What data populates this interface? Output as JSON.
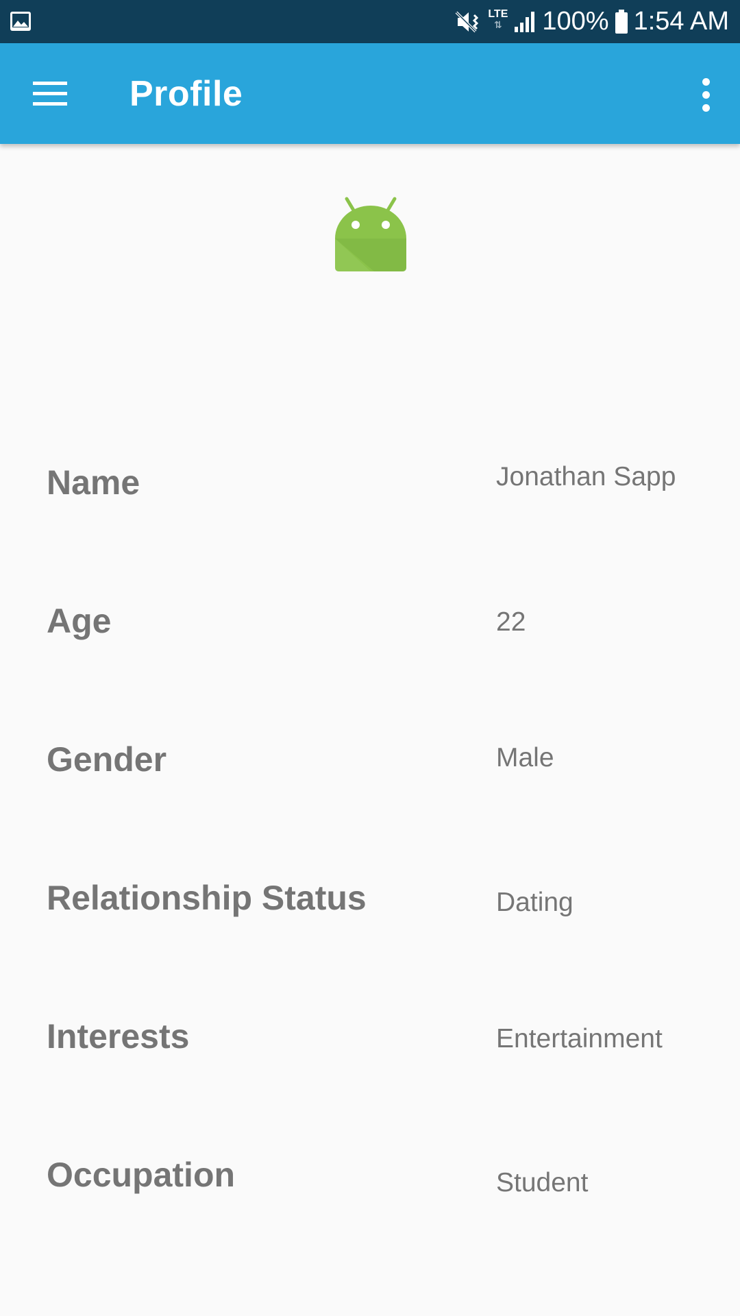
{
  "status_bar": {
    "battery": "100%",
    "time": "1:54 AM",
    "network": "LTE",
    "icons": [
      "image-notification-icon",
      "mute-vibrate-icon",
      "lte-icon",
      "signal-icon",
      "battery-icon"
    ]
  },
  "app_bar": {
    "title": "Profile",
    "background": "#29a5db",
    "menu_icon": "hamburger-menu-icon",
    "overflow_icon": "more-vert-icon"
  },
  "avatar": {
    "icon": "android-icon",
    "color": "#8bc34a"
  },
  "profile": {
    "rows": [
      {
        "label": "Name",
        "value": "Jonathan Sapp"
      },
      {
        "label": "Age",
        "value": "22"
      },
      {
        "label": "Gender",
        "value": "Male"
      },
      {
        "label": "Relationship Status",
        "value": "Dating"
      },
      {
        "label": "Interests",
        "value": "Entertainment"
      },
      {
        "label": "Occupation",
        "value": "Student"
      }
    ]
  }
}
